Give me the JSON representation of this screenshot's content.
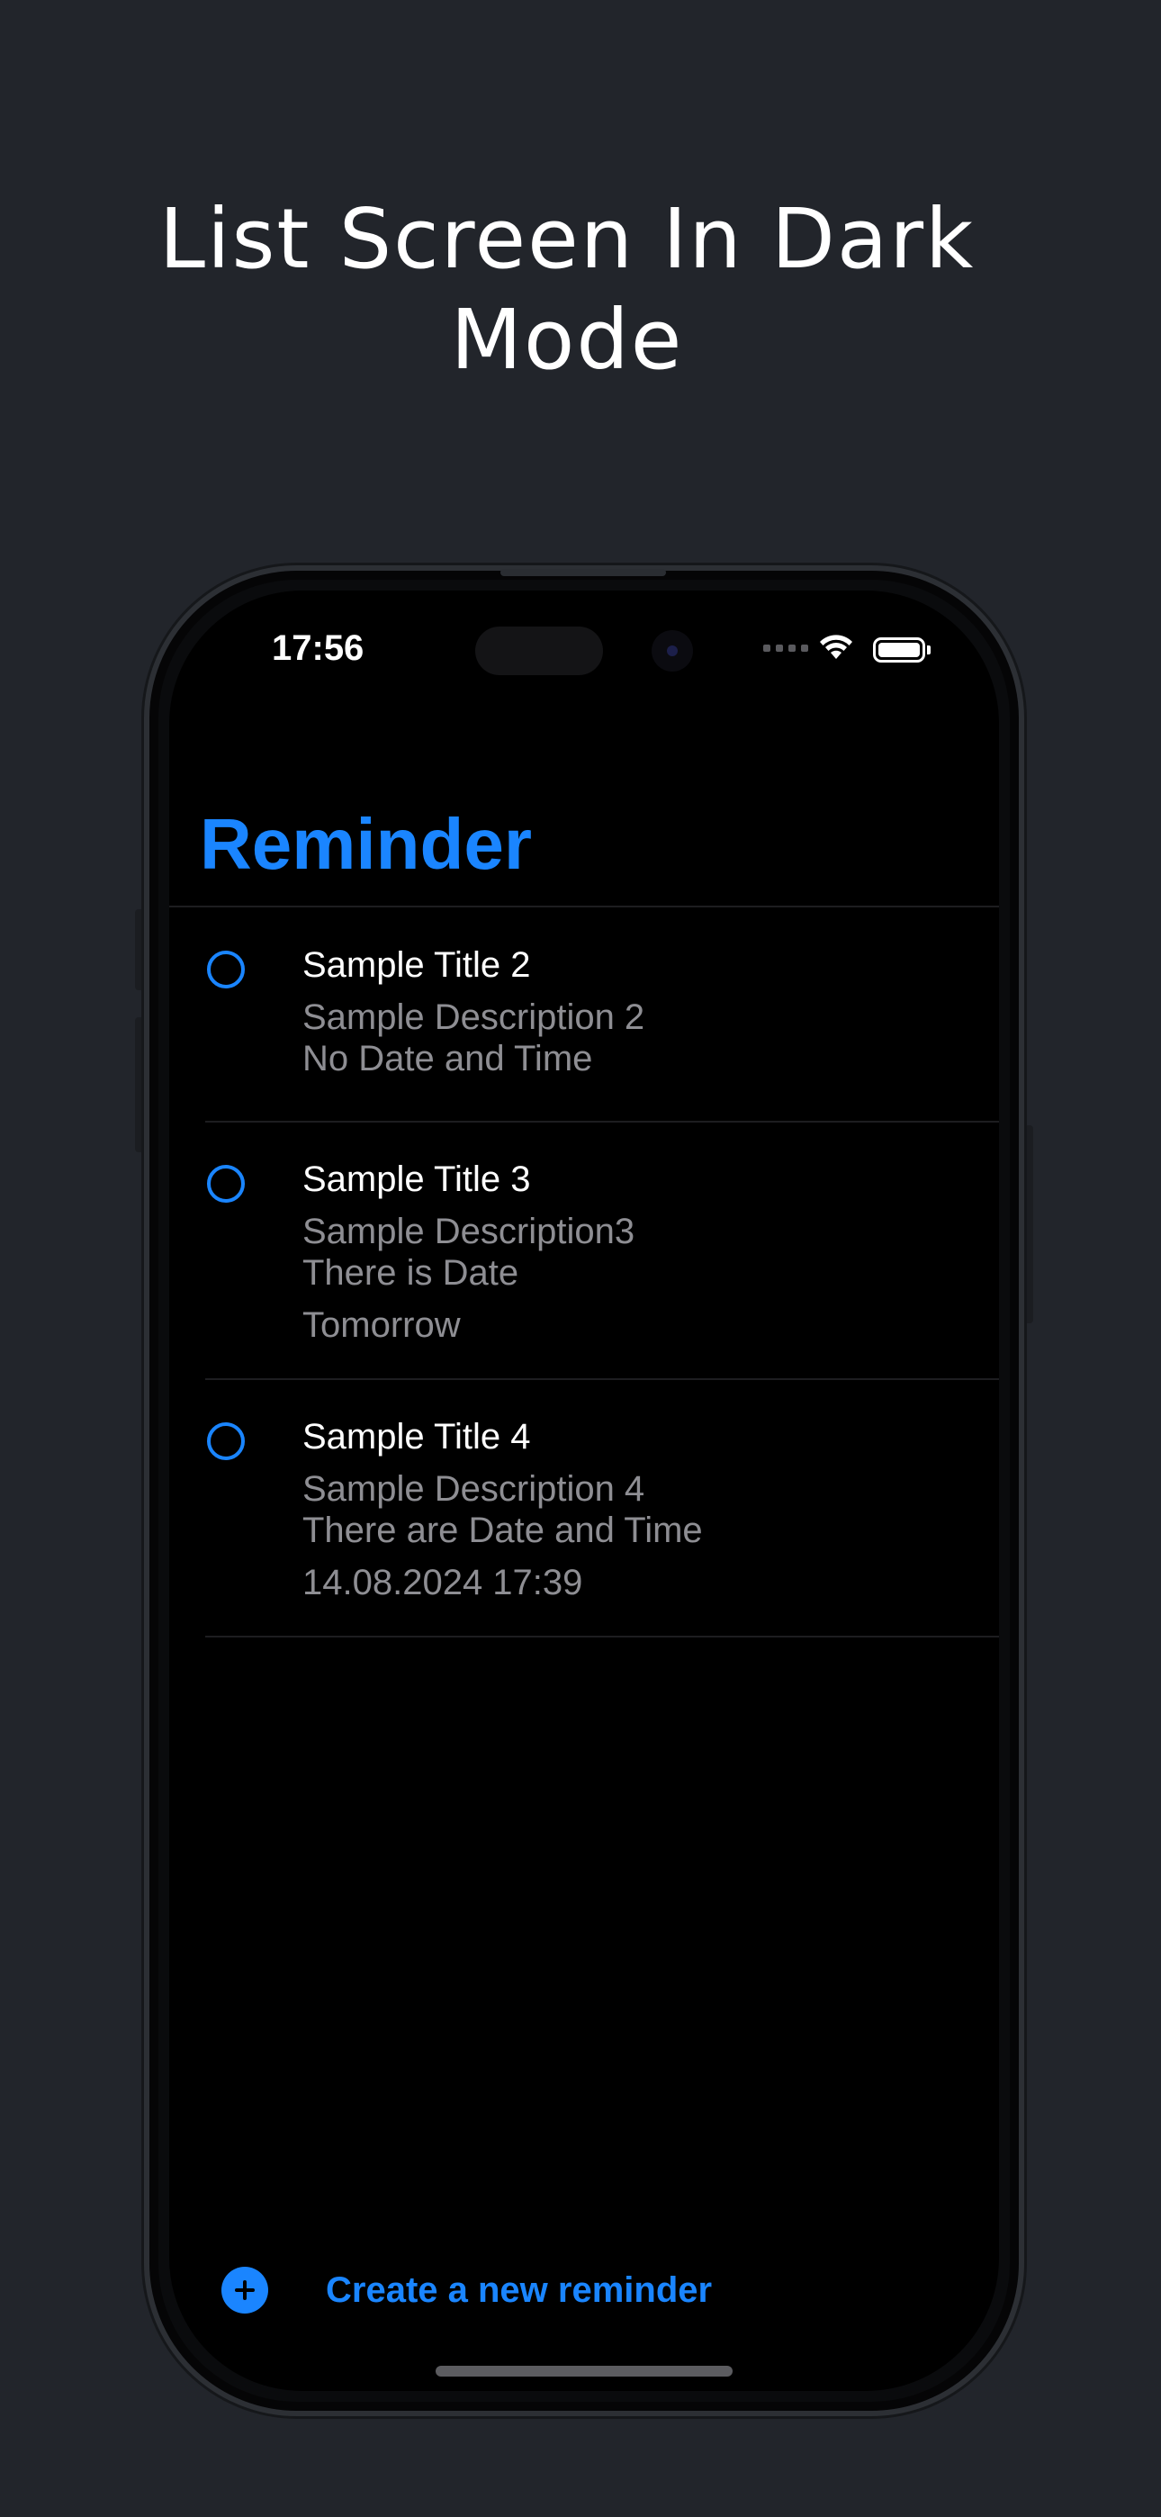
{
  "headline": {
    "line1": "List Screen In Dark",
    "line2": "Mode"
  },
  "status_bar": {
    "time": "17:56",
    "icons": [
      "cellular-signal-icon",
      "wifi-icon",
      "battery-icon"
    ]
  },
  "screen": {
    "title": "Reminder",
    "reminders": [
      {
        "title": "Sample Title 2",
        "description": "Sample Description 2",
        "note": "No Date and Time",
        "date": "",
        "completed": false
      },
      {
        "title": "Sample Title 3",
        "description": "Sample Description3",
        "note": "There is Date",
        "date": "Tomorrow",
        "completed": false
      },
      {
        "title": "Sample Title 4",
        "description": "Sample Description 4",
        "note": "There are Date and Time",
        "date": "14.08.2024 17:39",
        "completed": false
      }
    ]
  },
  "toolbar": {
    "add_label": "Create a new reminder",
    "add_icon": "plus-circle-icon"
  },
  "colors": {
    "background": "#22252b",
    "accent": "#1a85ff",
    "screen_background": "#000000",
    "secondary_text": "#8e8e93"
  }
}
